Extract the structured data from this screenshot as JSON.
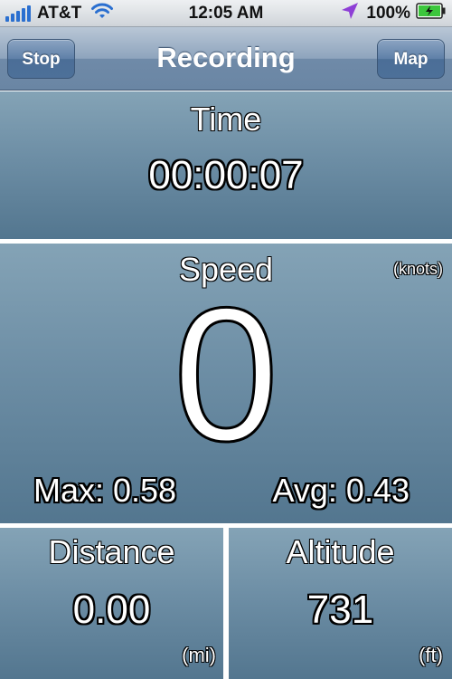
{
  "status_bar": {
    "carrier": "AT&T",
    "time": "12:05 AM",
    "battery": "100%",
    "icons": [
      "signal-bars-icon",
      "wifi-icon",
      "location-arrow-icon",
      "battery-charging-icon"
    ]
  },
  "nav": {
    "title": "Recording",
    "left_button": "Stop",
    "right_button": "Map"
  },
  "time_panel": {
    "label": "Time",
    "value": "00:00:07"
  },
  "speed_panel": {
    "label": "Speed",
    "unit": "(knots)",
    "value": "0",
    "max": "Max: 0.58",
    "avg": "Avg: 0.43"
  },
  "distance_panel": {
    "label": "Distance",
    "value": "0.00",
    "unit": "(mi)"
  },
  "altitude_panel": {
    "label": "Altitude",
    "value": "731",
    "unit": "(ft)"
  },
  "colors": {
    "accent": "#5f80a8",
    "panel_top": "#84a3b6",
    "panel_bottom": "#53768f",
    "signal": "#2a6fd0",
    "location": "#8e3fd6",
    "battery": "#3cc63c"
  }
}
